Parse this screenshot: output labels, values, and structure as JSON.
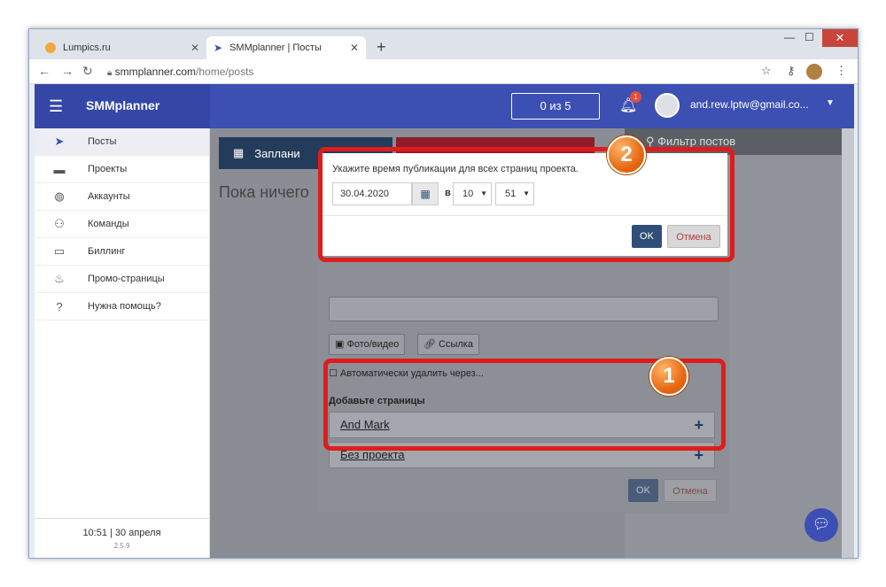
{
  "browser": {
    "tabs": [
      {
        "title": "Lumpics.ru",
        "fav_color": "#f2a93b"
      },
      {
        "title": "SMMplanner | Посты",
        "fav_color": "#3c4fb3"
      }
    ],
    "url_host": "smmplanner.com",
    "url_path": "/home/posts"
  },
  "header": {
    "brand": "SMMplanner",
    "quota": "0 из 5",
    "notif_count": "1",
    "user_email": "and.rew.lptw@gmail.co..."
  },
  "sidebar": {
    "items": [
      {
        "label": "Посты",
        "icon": "paper-plane-icon"
      },
      {
        "label": "Проекты",
        "icon": "folder-icon"
      },
      {
        "label": "Аккаунты",
        "icon": "globe-icon"
      },
      {
        "label": "Команды",
        "icon": "team-icon"
      },
      {
        "label": "Биллинг",
        "icon": "card-icon"
      },
      {
        "label": "Промо-страницы",
        "icon": "flame-icon"
      },
      {
        "label": "Нужна помощь?",
        "icon": "help-icon"
      }
    ],
    "footer_time": "10:51  |  30 апреля",
    "version": "2.5.9"
  },
  "main": {
    "plan_button": "Заплани",
    "empty_text": "Пока ничего",
    "filter_title": "Фильтр постов"
  },
  "modal": {
    "photo_button": "Фото/видео",
    "link_button": "Ссылка",
    "auto_delete": "Автоматически удалить через...",
    "add_pages_title": "Добавьте страницы",
    "pages": [
      "And Mark",
      "Без проекта"
    ],
    "ok": "OK",
    "cancel": "Отмена"
  },
  "time_dialog": {
    "label": "Укажите время публикации для всех страниц проекта.",
    "date": "30.04.2020",
    "at": "в",
    "hour": "10",
    "minute": "51",
    "ok": "OK",
    "cancel": "Отмена"
  },
  "callouts": {
    "first": "1",
    "second": "2"
  },
  "colors": {
    "header": "#3c4fb3",
    "highlight": "#e01b1b",
    "callout": "#e86a12"
  }
}
